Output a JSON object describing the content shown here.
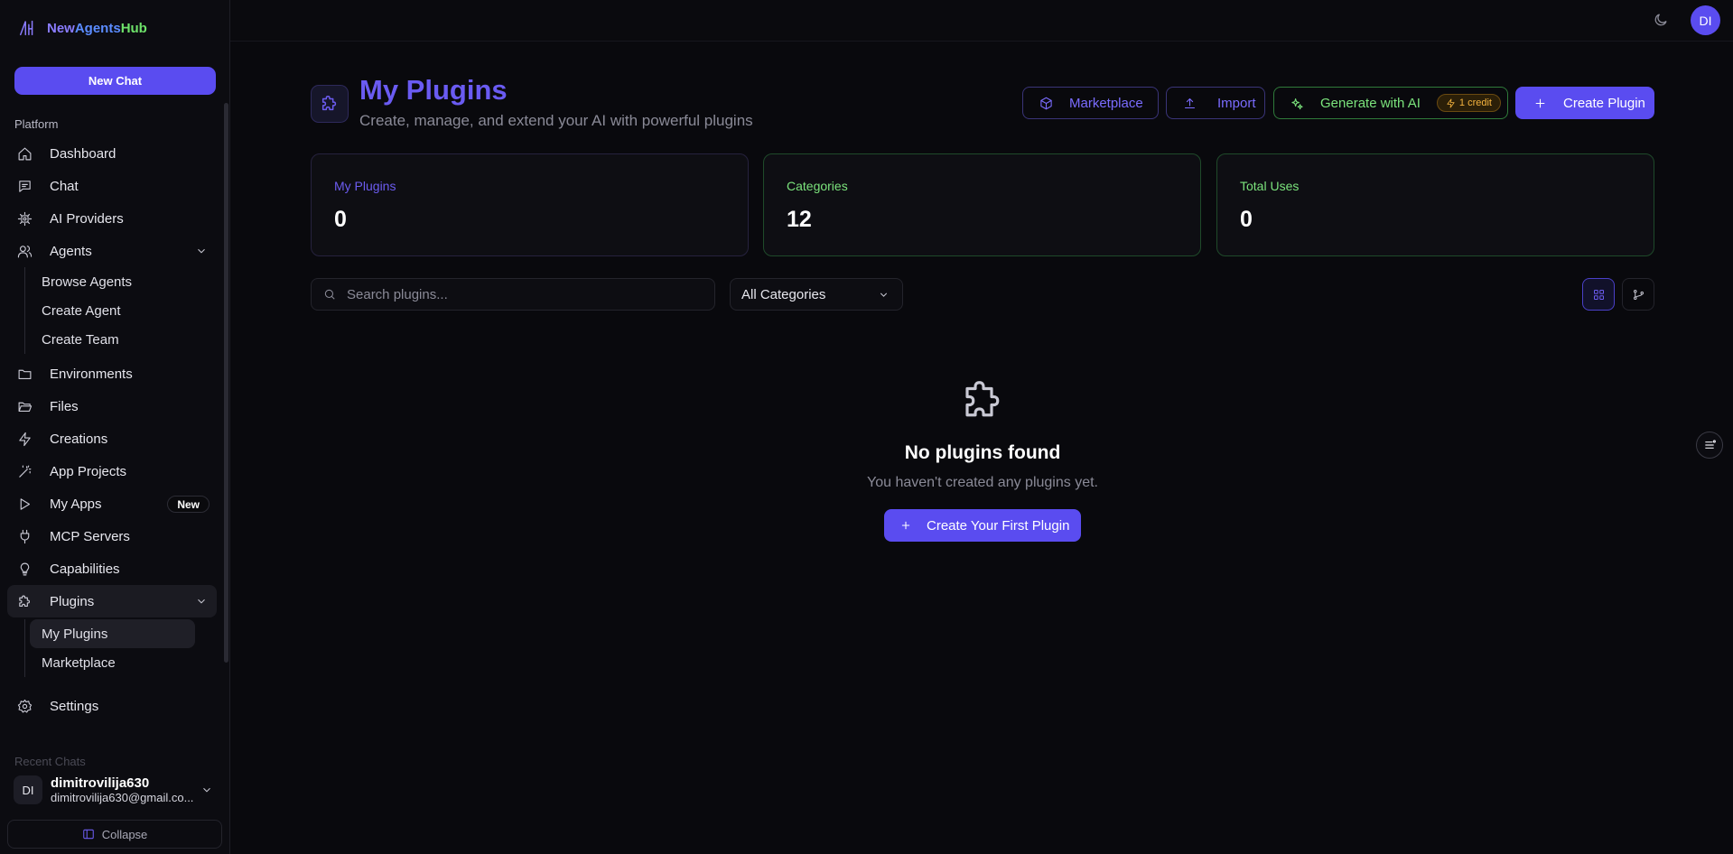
{
  "brand": {
    "part1": "New",
    "part2": "Agents",
    "part3": "Hub"
  },
  "sidebar": {
    "new_chat": "New Chat",
    "section": "Platform",
    "items": [
      {
        "label": "Dashboard",
        "icon": "home-icon"
      },
      {
        "label": "Chat",
        "icon": "chat-icon"
      },
      {
        "label": "AI Providers",
        "icon": "cpu-icon"
      },
      {
        "label": "Agents",
        "icon": "users-icon"
      },
      {
        "label": "Environments",
        "icon": "folder-icon"
      },
      {
        "label": "Files",
        "icon": "folder-open-icon"
      },
      {
        "label": "Creations",
        "icon": "bolt-icon"
      },
      {
        "label": "App Projects",
        "icon": "wand-icon"
      },
      {
        "label": "My Apps",
        "icon": "play-icon",
        "badge": "New"
      },
      {
        "label": "MCP Servers",
        "icon": "plug-icon"
      },
      {
        "label": "Capabilities",
        "icon": "bulb-icon"
      },
      {
        "label": "Plugins",
        "icon": "puzzle-icon"
      },
      {
        "label": "Settings",
        "icon": "gear-icon"
      }
    ],
    "agents_sub": [
      "Browse Agents",
      "Create Agent",
      "Create Team"
    ],
    "plugins_sub": [
      "My Plugins",
      "Marketplace"
    ],
    "recent": "Recent Chats",
    "user": {
      "initials": "DI",
      "name": "dimitrovilija630",
      "email": "dimitrovilija630@gmail.co..."
    },
    "collapse": "Collapse"
  },
  "topbar": {
    "avatar": "DI"
  },
  "header": {
    "title": "My Plugins",
    "subtitle": "Create, manage, and extend your AI with powerful plugins",
    "marketplace": "Marketplace",
    "import": "Import",
    "generate": "Generate with AI",
    "credit": "1 credit",
    "create": "Create Plugin"
  },
  "stats": [
    {
      "label": "My Plugins",
      "value": "0"
    },
    {
      "label": "Categories",
      "value": "12"
    },
    {
      "label": "Total Uses",
      "value": "0"
    }
  ],
  "filters": {
    "search_placeholder": "Search plugins...",
    "category": "All Categories"
  },
  "empty": {
    "title": "No plugins found",
    "subtitle": "You haven't created any plugins yet.",
    "button": "Create Your First Plugin"
  },
  "colors": {
    "accent": "#5a4cf0",
    "green": "#7be37c",
    "amber": "#f5b33e",
    "bg": "#09090d"
  }
}
